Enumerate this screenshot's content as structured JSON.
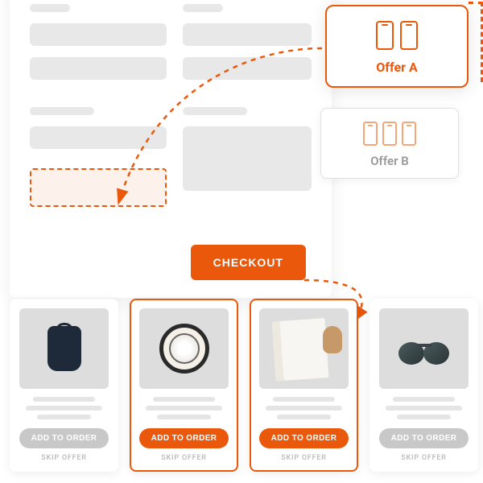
{
  "checkout": {
    "button_label": "CHECKOUT"
  },
  "offers": {
    "a": {
      "label": "Offer A"
    },
    "b": {
      "label": "Offer B"
    }
  },
  "products": [
    {
      "name": "backpack",
      "add_label": "ADD TO ORDER",
      "skip_label": "SKIP OFFER",
      "highlighted": false
    },
    {
      "name": "watch",
      "add_label": "ADD TO ORDER",
      "skip_label": "SKIP OFFER",
      "highlighted": true
    },
    {
      "name": "shirt",
      "add_label": "ADD TO ORDER",
      "skip_label": "SKIP OFFER",
      "highlighted": true
    },
    {
      "name": "sunglasses",
      "add_label": "ADD TO ORDER",
      "skip_label": "SKIP OFFER",
      "highlighted": false
    }
  ]
}
